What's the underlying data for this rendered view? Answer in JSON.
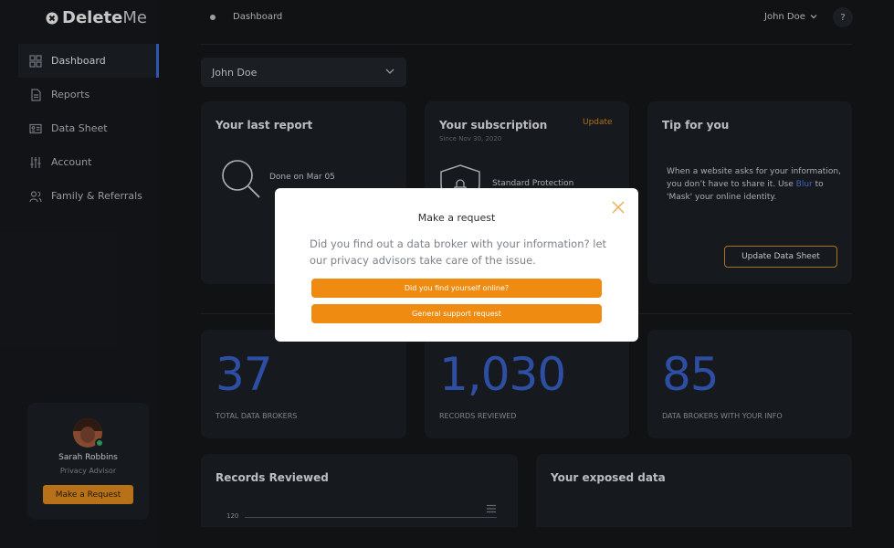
{
  "app": {
    "logo_icon": "x-logo-icon",
    "logo_bold": "Delete",
    "logo_light": "Me"
  },
  "sidebar": {
    "items": [
      {
        "label": "Dashboard",
        "icon": "grid-icon",
        "active": true
      },
      {
        "label": "Reports",
        "icon": "document-icon"
      },
      {
        "label": "Data Sheet",
        "icon": "id-card-icon"
      },
      {
        "label": "Account",
        "icon": "sliders-icon"
      },
      {
        "label": "Family & Referrals",
        "icon": "users-icon"
      }
    ],
    "advisor": {
      "name": "Sarah Robbins",
      "role": "Privacy Advisor",
      "button": "Make a Request"
    }
  },
  "header": {
    "breadcrumb": "Dashboard",
    "user": "John Doe",
    "help": "?"
  },
  "profile_select": {
    "value": "John Doe"
  },
  "cards": {
    "last_report": {
      "title": "Your last report",
      "status": "Done on Mar 05"
    },
    "subscription": {
      "title": "Your subscription",
      "since": "Since Nov 30, 2020",
      "update": "Update",
      "plan": "Standard Protection"
    },
    "tip": {
      "title": "Tip for you",
      "text_before": "When a website asks for your information, you don’t have to share it. Use ",
      "link": "Blur",
      "text_after": " to 'Mask' your online identity.",
      "button": "Update Data Sheet"
    }
  },
  "stats": [
    {
      "value": "37",
      "label": "TOTAL DATA BROKERS"
    },
    {
      "value": "1,030",
      "label": "RECORDS REVIEWED"
    },
    {
      "value": "85",
      "label": "DATA BROKERS WITH YOUR INFO"
    }
  ],
  "records_chart": {
    "title": "Records Reviewed",
    "tick": "120"
  },
  "exposed": {
    "title": "Your exposed data"
  },
  "modal": {
    "title": "Make a request",
    "description": "Did you find out a data broker with your information? let our privacy advisors take care of the issue.",
    "buttons": [
      "Did you find yourself online?",
      "General support request"
    ]
  },
  "colors": {
    "accent": "#ee8b10",
    "stat_blue": "#3960c9",
    "background": "#141619",
    "card": "#1c1f24"
  }
}
